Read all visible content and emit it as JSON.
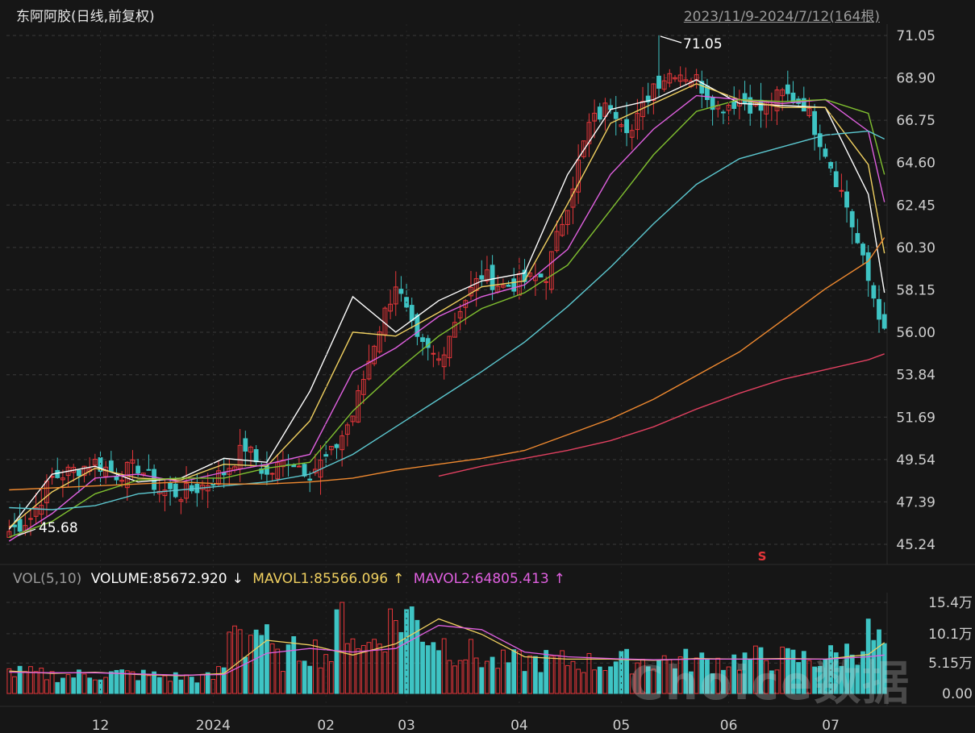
{
  "header": {
    "title": "东阿阿胶(日线,前复权)",
    "range": "2023/11/9-2024/7/12(164根)"
  },
  "volume_header": {
    "name": "VOL(5,10)",
    "volume_label": "VOLUME:85672.920",
    "volume_arrow": "↓",
    "mavol1_label": "MAVOL1:85566.096",
    "mavol1_arrow": "↑",
    "mavol2_label": "MAVOL2:64805.413",
    "mavol2_arrow": "↑"
  },
  "annotations": {
    "high_label": "71.05",
    "low_label": "45.68",
    "marker": "S"
  },
  "watermark": "Choice数据",
  "colors": {
    "background": "#161616",
    "up": "#e6363a",
    "down": "#3ec4c4",
    "ma5": "#ffffff",
    "ma10": "#f0d060",
    "ma20": "#e060e0",
    "ma30": "#80c030",
    "ma60": "#5cc8d0",
    "ma120": "#f08a30",
    "ma250": "#e04060",
    "mavol1": "#f0d060",
    "mavol2": "#e060e0"
  },
  "chart_data": [
    {
      "type": "candlestick",
      "title": "东阿阿胶(日线,前复权)",
      "ylim": [
        45.24,
        71.05
      ],
      "y_ticks": [
        "71.05",
        "68.90",
        "66.75",
        "64.60",
        "62.45",
        "60.30",
        "58.15",
        "56.00",
        "53.84",
        "51.69",
        "49.54",
        "47.39",
        "45.24"
      ],
      "x_ticks": [
        "12",
        "2024",
        "02",
        "03",
        "04",
        "05",
        "06",
        "07"
      ],
      "high": 71.05,
      "low": 45.68,
      "price_anchors": [
        {
          "i": 0,
          "c": 45.9
        },
        {
          "i": 4,
          "c": 46.6
        },
        {
          "i": 8,
          "c": 48.6
        },
        {
          "i": 12,
          "c": 49.0
        },
        {
          "i": 16,
          "c": 49.4
        },
        {
          "i": 20,
          "c": 48.8
        },
        {
          "i": 24,
          "c": 49.2
        },
        {
          "i": 28,
          "c": 48.0
        },
        {
          "i": 32,
          "c": 47.8
        },
        {
          "i": 36,
          "c": 48.2
        },
        {
          "i": 40,
          "c": 48.9
        },
        {
          "i": 44,
          "c": 50.2
        },
        {
          "i": 48,
          "c": 48.7
        },
        {
          "i": 52,
          "c": 49.6
        },
        {
          "i": 56,
          "c": 48.9
        },
        {
          "i": 60,
          "c": 49.8
        },
        {
          "i": 64,
          "c": 51.8
        },
        {
          "i": 68,
          "c": 55.5
        },
        {
          "i": 72,
          "c": 58.5
        },
        {
          "i": 76,
          "c": 55.4
        },
        {
          "i": 80,
          "c": 54.6
        },
        {
          "i": 84,
          "c": 57.3
        },
        {
          "i": 88,
          "c": 58.9
        },
        {
          "i": 92,
          "c": 58.3
        },
        {
          "i": 96,
          "c": 58.6
        },
        {
          "i": 100,
          "c": 58.9
        },
        {
          "i": 104,
          "c": 62.6
        },
        {
          "i": 108,
          "c": 66.5
        },
        {
          "i": 112,
          "c": 67.6
        },
        {
          "i": 116,
          "c": 66.2
        },
        {
          "i": 120,
          "c": 68.6
        },
        {
          "i": 124,
          "c": 69.3
        },
        {
          "i": 128,
          "c": 68.8
        },
        {
          "i": 132,
          "c": 67.4
        },
        {
          "i": 136,
          "c": 67.8
        },
        {
          "i": 140,
          "c": 67.3
        },
        {
          "i": 144,
          "c": 68.1
        },
        {
          "i": 148,
          "c": 67.6
        },
        {
          "i": 152,
          "c": 65.2
        },
        {
          "i": 156,
          "c": 62.4
        },
        {
          "i": 160,
          "c": 58.6
        },
        {
          "i": 163,
          "c": 56.2
        }
      ],
      "series": [
        {
          "name": "MA5",
          "values": [
            46.0,
            48.8,
            49.2,
            48.4,
            48.6,
            49.6,
            49.4,
            53.0,
            57.8,
            56.0,
            57.6,
            58.6,
            59.0,
            64.0,
            67.3,
            67.8,
            68.8,
            67.6,
            67.5,
            67.4,
            63.0,
            58.0
          ]
        },
        {
          "name": "MA10",
          "values": [
            46.1,
            47.9,
            49.1,
            48.6,
            48.5,
            49.3,
            49.2,
            51.5,
            56.0,
            55.8,
            57.0,
            58.3,
            58.6,
            62.5,
            66.6,
            67.6,
            68.6,
            67.8,
            67.4,
            67.4,
            64.5,
            60.0
          ]
        },
        {
          "name": "MA20",
          "values": [
            45.4,
            46.8,
            48.6,
            48.8,
            48.4,
            48.9,
            49.3,
            49.8,
            54.0,
            55.2,
            56.8,
            57.8,
            58.4,
            60.2,
            64.0,
            66.3,
            68.0,
            67.8,
            67.6,
            67.8,
            66.2,
            62.6
          ]
        },
        {
          "name": "MA30",
          "values": [
            45.6,
            46.4,
            47.8,
            48.5,
            48.6,
            48.6,
            49.1,
            49.4,
            52.0,
            54.0,
            55.8,
            57.2,
            58.0,
            59.4,
            62.2,
            65.0,
            67.2,
            67.8,
            67.7,
            67.8,
            67.1,
            64.0
          ]
        },
        {
          "name": "MA60",
          "values": [
            47.1,
            47.0,
            47.2,
            47.8,
            48.0,
            48.2,
            48.4,
            48.8,
            49.8,
            51.2,
            52.6,
            54.0,
            55.5,
            57.3,
            59.3,
            61.5,
            63.5,
            64.8,
            65.4,
            66.0,
            66.2,
            65.8
          ]
        },
        {
          "name": "MA120",
          "values": [
            48.0,
            48.1,
            48.2,
            48.3,
            48.4,
            48.3,
            48.3,
            48.4,
            48.6,
            49.0,
            49.3,
            49.6,
            50.0,
            50.8,
            51.6,
            52.6,
            53.8,
            55.0,
            56.6,
            58.2,
            59.6,
            60.8
          ]
        },
        {
          "name": "MA250",
          "values": [
            null,
            null,
            null,
            null,
            null,
            null,
            null,
            null,
            null,
            null,
            48.7,
            49.2,
            49.6,
            50.0,
            50.5,
            51.2,
            52.1,
            52.9,
            53.6,
            54.1,
            54.6,
            54.9
          ]
        }
      ]
    },
    {
      "type": "bar",
      "title": "VOL(5,10)",
      "ylim": [
        0,
        15.4
      ],
      "y_ticks": [
        "15.4万",
        "10.1万",
        "5.15万",
        "0.00"
      ],
      "volume_anchors": [
        {
          "i": 0,
          "v": 3.8
        },
        {
          "i": 10,
          "v": 3.2
        },
        {
          "i": 20,
          "v": 3.6
        },
        {
          "i": 30,
          "v": 3.0
        },
        {
          "i": 38,
          "v": 2.8
        },
        {
          "i": 40,
          "v": 5.0
        },
        {
          "i": 42,
          "v": 15.4
        },
        {
          "i": 44,
          "v": 9.0
        },
        {
          "i": 46,
          "v": 12.5
        },
        {
          "i": 50,
          "v": 6.0
        },
        {
          "i": 55,
          "v": 8.5
        },
        {
          "i": 60,
          "v": 7.0
        },
        {
          "i": 62,
          "v": 15.4
        },
        {
          "i": 66,
          "v": 8.0
        },
        {
          "i": 70,
          "v": 12.0
        },
        {
          "i": 74,
          "v": 14.8
        },
        {
          "i": 78,
          "v": 11.0
        },
        {
          "i": 82,
          "v": 8.5
        },
        {
          "i": 86,
          "v": 7.2
        },
        {
          "i": 90,
          "v": 5.6
        },
        {
          "i": 100,
          "v": 6.0
        },
        {
          "i": 110,
          "v": 5.5
        },
        {
          "i": 120,
          "v": 6.2
        },
        {
          "i": 130,
          "v": 5.8
        },
        {
          "i": 140,
          "v": 6.4
        },
        {
          "i": 150,
          "v": 6.2
        },
        {
          "i": 155,
          "v": 7.0
        },
        {
          "i": 158,
          "v": 8.5
        },
        {
          "i": 160,
          "v": 10.5
        },
        {
          "i": 163,
          "v": 8.6
        }
      ],
      "series": [
        {
          "name": "MAVOL1",
          "values": [
            3.8,
            3.4,
            3.6,
            3.2,
            3.0,
            3.4,
            9.0,
            8.2,
            6.5,
            8.4,
            12.6,
            10.0,
            6.2,
            5.8,
            5.8,
            5.6,
            5.9,
            5.8,
            5.9,
            5.8,
            6.6,
            8.6
          ]
        },
        {
          "name": "MAVOL2",
          "values": [
            3.6,
            3.5,
            3.5,
            3.3,
            3.1,
            3.2,
            6.8,
            7.6,
            7.0,
            7.6,
            11.5,
            10.8,
            7.0,
            6.2,
            5.9,
            5.7,
            5.8,
            5.8,
            5.8,
            5.8,
            6.2,
            6.5
          ]
        }
      ]
    }
  ]
}
